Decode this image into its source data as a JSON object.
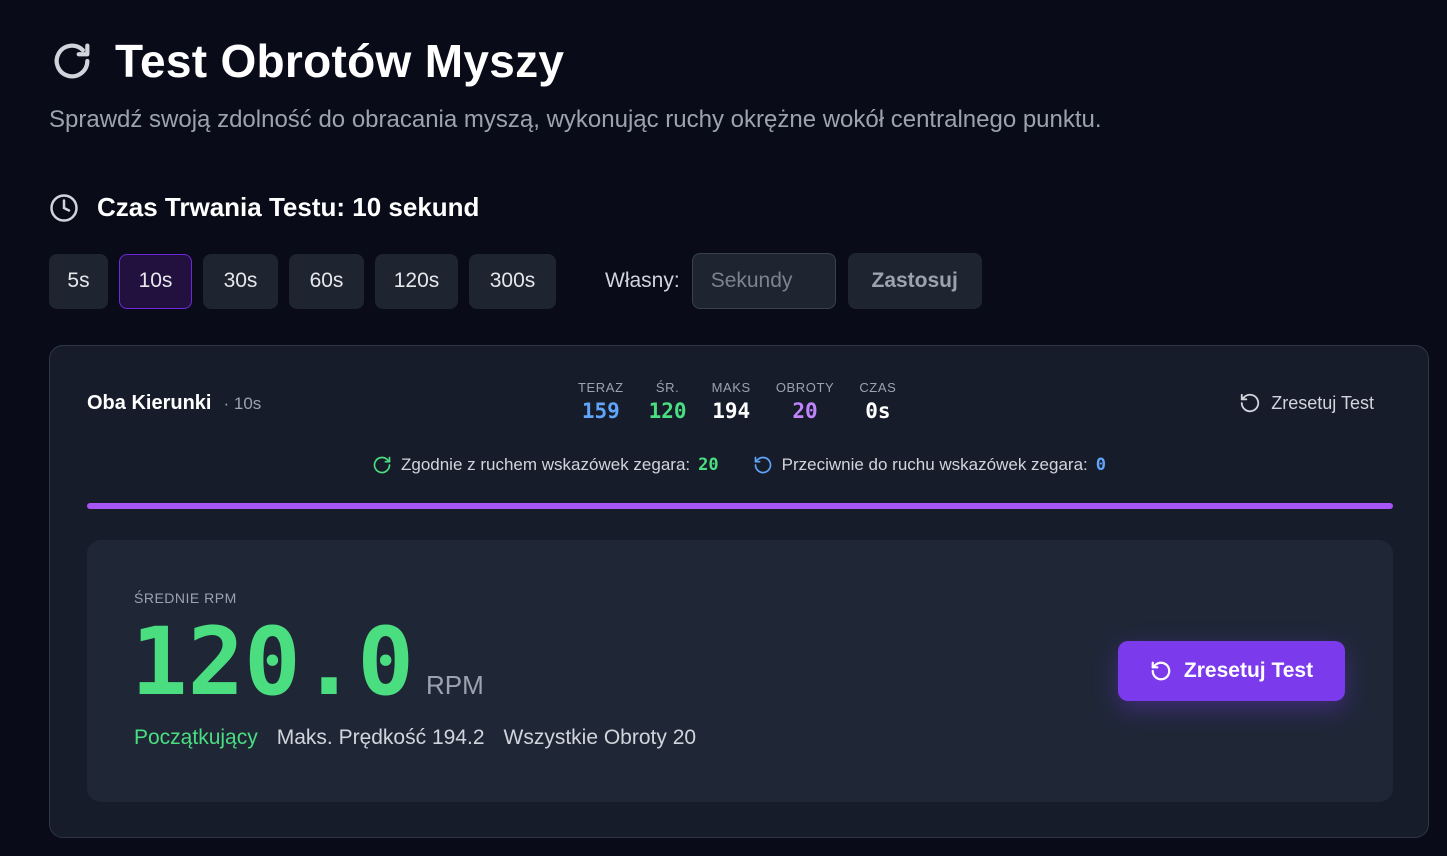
{
  "header": {
    "title": "Test Obrotów Myszy",
    "subtitle": "Sprawdź swoją zdolność do obracania myszą, wykonując ruchy okrężne wokół centralnego punktu."
  },
  "duration": {
    "label": "Czas Trwania Testu: 10 sekund",
    "options": [
      "5s",
      "10s",
      "30s",
      "60s",
      "120s",
      "300s"
    ],
    "selected": "10s",
    "custom_label": "Własny:",
    "custom_placeholder": "Sekundy",
    "apply_label": "Zastosuj"
  },
  "card": {
    "mode_name": "Oba Kierunki",
    "mode_duration": "· 10s",
    "stats": [
      {
        "label": "TERAZ",
        "value": "159",
        "color": "#60a5fa"
      },
      {
        "label": "ŚR.",
        "value": "120",
        "color": "#4ade80"
      },
      {
        "label": "MAKS",
        "value": "194",
        "color": "#ffffff"
      },
      {
        "label": "OBROTY",
        "value": "20",
        "color": "#c084fc"
      },
      {
        "label": "CZAS",
        "value": "0s",
        "color": "#ffffff"
      }
    ],
    "reset_link": "Zresetuj Test",
    "clockwise_label": "Zgodnie z ruchem wskazówek zegara:",
    "clockwise_value": "20",
    "counter_label": "Przeciwnie do ruchu wskazówek zegara:",
    "counter_value": "0",
    "progress_fraction": 1.0
  },
  "result": {
    "avg_label": "ŚREDNIE RPM",
    "avg_value": "120.0",
    "avg_unit": "RPM",
    "level": "Początkujący",
    "max_speed": "Maks. Prędkość 194.2",
    "total_rotations": "Wszystkie Obroty 20",
    "reset_button": "Zresetuj Test"
  },
  "colors": {
    "accent": "#7c3aed",
    "progress": "#a855f7",
    "green": "#4ade80",
    "blue": "#60a5fa",
    "purple": "#c084fc"
  }
}
